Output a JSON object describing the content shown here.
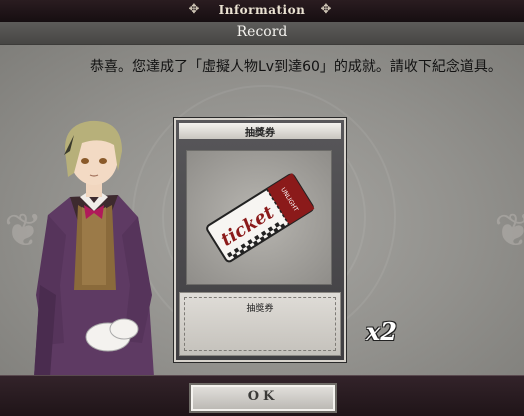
{
  "header": {
    "title": "Information"
  },
  "subheader": {
    "title": "Record"
  },
  "message": "恭喜。您達成了「虛擬人物Lv到達60」的成就。請收下紀念道具。",
  "card": {
    "title": "抽獎券",
    "item_name": "抽獎券",
    "ticket_text": "ticket",
    "ticket_stub_text": "UNLIGHT"
  },
  "quantity": "x2",
  "footer": {
    "ok_label": "OK"
  },
  "colors": {
    "header_bg": "#1c1216",
    "panel_bg": "#92918d",
    "ticket_red": "#8b1a1a"
  },
  "icons": {
    "header_ornament": "fleur-ornament-icon"
  }
}
